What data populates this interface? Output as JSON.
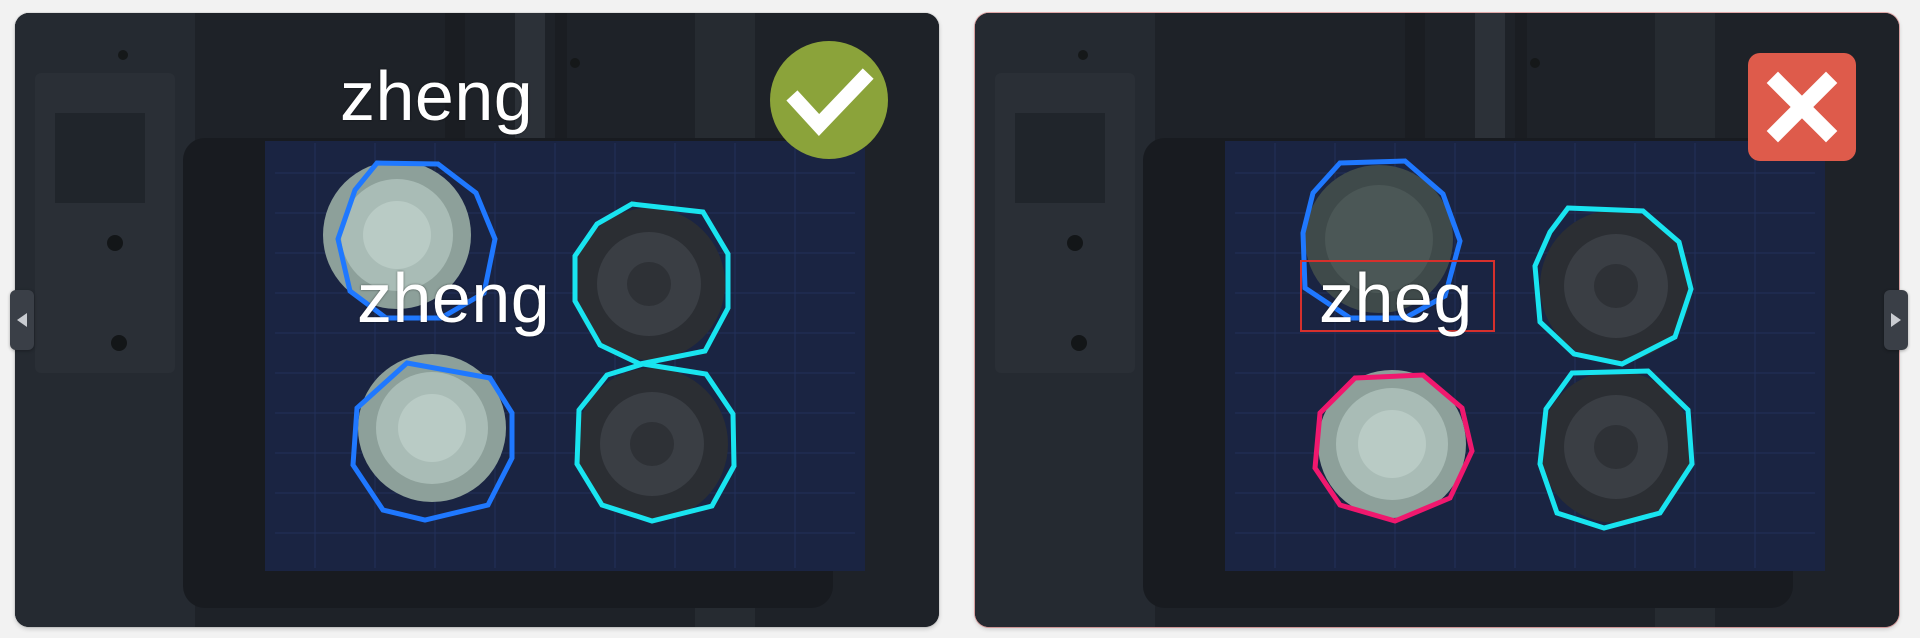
{
  "panels": [
    {
      "status": "correct",
      "status_icon": "check-icon",
      "status_color": "#8ba33a",
      "labels": [
        "zheng",
        "zheng"
      ]
    },
    {
      "status": "incorrect",
      "status_icon": "close-icon",
      "status_color": "#de5b4b",
      "labels": [
        "zheg"
      ]
    }
  ],
  "outline_colors": {
    "blue": "#1f78ff",
    "cyan": "#19e4f0",
    "pink": "#f0186e",
    "error_box": "#d6302c"
  },
  "navigation": {
    "prev_icon": "chevron-left-icon",
    "next_icon": "chevron-right-icon"
  }
}
